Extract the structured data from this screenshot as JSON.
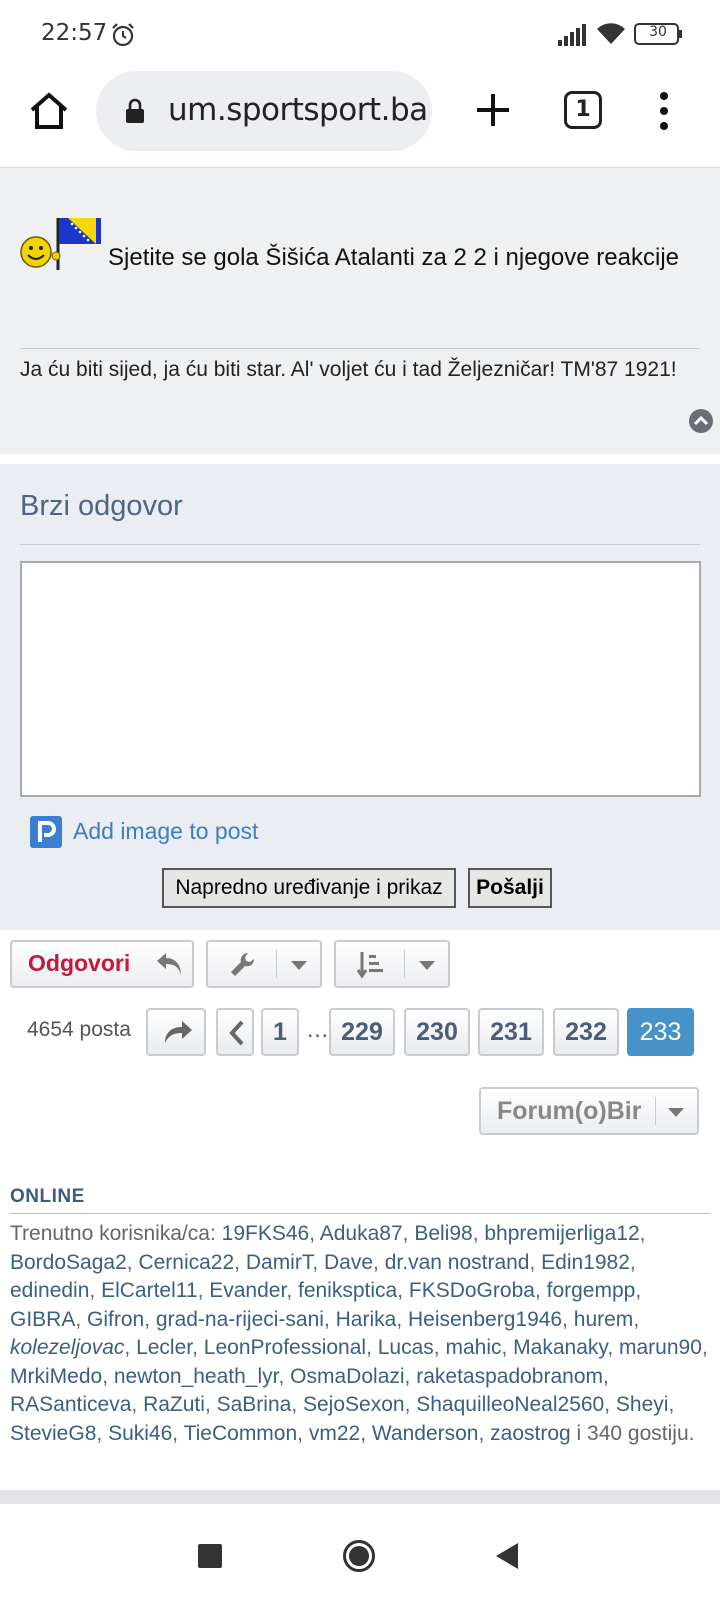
{
  "status_bar": {
    "time": "22:57",
    "battery": "30",
    "icons": [
      "alarm-icon",
      "signal-icon",
      "wifi-icon",
      "battery-icon"
    ]
  },
  "browser": {
    "url": "um.sportsport.ba",
    "tab_count": "1",
    "icons": [
      "home-icon",
      "lock-icon",
      "plus-icon",
      "menu-icon"
    ]
  },
  "post": {
    "text": "Sjetite se gola Šišića Atalanti za 2 2 i njegove reakcije",
    "signature": "Ja ću biti sijed, ja ću biti star. Al' voljet ću i tad Željezničar! TM'87 1921!"
  },
  "quick_reply": {
    "title": "Brzi odgovor",
    "textarea_value": "",
    "add_image_label": "Add image to post",
    "advanced_button": "Napredno uređivanje i prikaz",
    "submit_button": "Pošalji"
  },
  "actions": {
    "reply_label": "Odgovori"
  },
  "pagination": {
    "post_count": "4654 posta",
    "first": "1",
    "ellipsis": "…",
    "pages": [
      "229",
      "230",
      "231",
      "232"
    ],
    "current": "233"
  },
  "jump": {
    "label": "Forum(o)Bir"
  },
  "online": {
    "title": "ONLINE",
    "prefix": "Trenutno korisnika/ca: ",
    "users": [
      "19FKS46",
      "Aduka87",
      "Beli98",
      "bhpremijerliga12",
      "BordoSaga2",
      "Cernica22",
      "DamirT",
      "Dave",
      "dr.van nostrand",
      "Edin1982",
      "edinedin",
      "ElCartel11",
      "Evander",
      "feniksptica",
      "FKSDoGroba",
      "forgempp",
      "GIBRA",
      "Gifron",
      "grad-na-rijeci-sani",
      "Harika",
      "Heisenberg1946",
      "hurem",
      "kolezeljovac",
      "Lecler",
      "LeonProfessional",
      "Lucas",
      "mahic",
      "Makanaky",
      "marun90",
      "MrkiMedo",
      "newton_heath_lyr",
      "OsmaDolazi",
      "raketaspadobranom",
      "RASanticeva",
      "RaZuti",
      "SaBrina",
      "SejoSexon",
      "ShaquilleoNeal2560",
      "Sheyi",
      "StevieG8",
      "Suki46",
      "TieCommon",
      "vm22",
      "Wanderson",
      "zaostrog"
    ],
    "italic_user": "kolezeljovac",
    "suffix": " i 340 gostiju."
  }
}
